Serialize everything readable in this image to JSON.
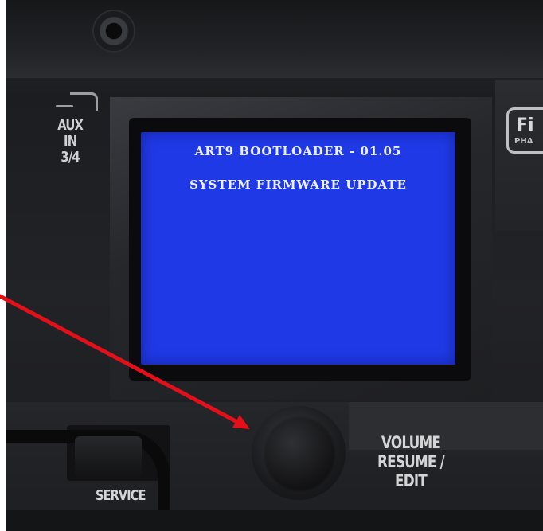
{
  "screen": {
    "line1": "ART9 BOOTLOADER - 01.05",
    "line2": "SYSTEM FIRMWARE UPDATE",
    "background_color": "#1f39e6"
  },
  "panel_labels": {
    "aux_line1": "AUX IN",
    "aux_line2": "3/4",
    "volume_line1": "VOLUME",
    "volume_line2": "RESUME / EDIT",
    "service": "SERVICE"
  },
  "logo": {
    "big": "Fi",
    "small": "PHA"
  },
  "annotation": {
    "arrow_color": "#e3101a",
    "points_to": "volume-knob"
  }
}
